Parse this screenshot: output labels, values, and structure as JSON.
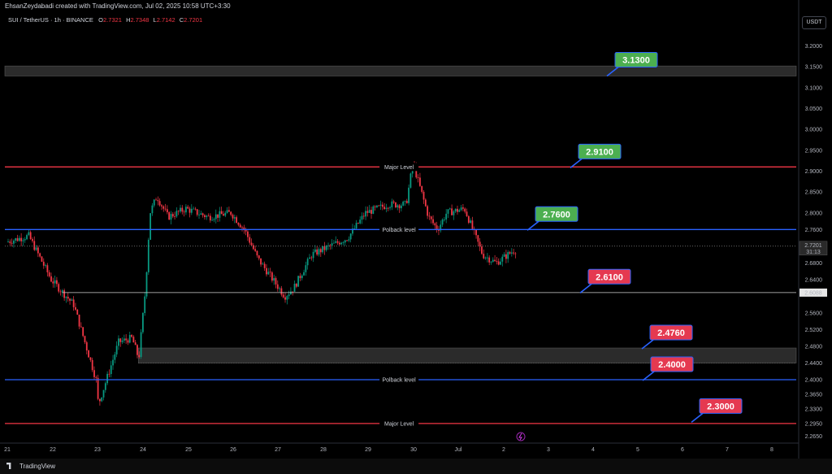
{
  "header": {
    "attribution": "EhsanZeydabadi created with TradingView.com, Jul 02, 2025 10:58 UTC+3:30",
    "symbol": "SUI / TetherUS · 1h · BINANCE",
    "ohlc": [
      {
        "key": "O",
        "value": "2.7321"
      },
      {
        "key": "H",
        "value": "2.7348"
      },
      {
        "key": "L",
        "value": "2.7142"
      },
      {
        "key": "C",
        "value": "2.7201"
      }
    ],
    "currency": "USDT"
  },
  "footer": {
    "brand": "TradingView"
  },
  "colors": {
    "background": "#000000",
    "bull": "#089981",
    "bear": "#f23645",
    "major_line": "#f23645",
    "pullback_line": "#2962ff",
    "tag_green": "#4caf50",
    "tag_red": "#e53950"
  },
  "chart_data": {
    "type": "candlestick",
    "ylim": [
      2.25,
      3.24
    ],
    "y_ticks": [
      "3.2000",
      "3.1500",
      "3.1000",
      "3.0500",
      "3.0000",
      "2.9500",
      "2.9000",
      "2.8500",
      "2.8000",
      "2.7600",
      "2.7201",
      "2.6800",
      "2.6400",
      "2.6088",
      "2.5600",
      "2.5200",
      "2.4800",
      "2.4400",
      "2.4000",
      "2.3650",
      "2.3300",
      "2.2950",
      "2.2650"
    ],
    "x_ticks": [
      "21",
      "22",
      "23",
      "24",
      "25",
      "26",
      "27",
      "28",
      "29",
      "30",
      "Jul",
      "2",
      "3",
      "4",
      "5",
      "6",
      "7",
      "8"
    ],
    "last_price": {
      "value": "2.7201",
      "countdown": "31:13"
    },
    "marked_price": "2.6088",
    "levels": [
      {
        "price": 2.91,
        "label": "Major Level",
        "kind": "major"
      },
      {
        "price": 2.76,
        "label": "Polback level",
        "kind": "pullback"
      },
      {
        "price": 2.4,
        "label": "Polback level",
        "kind": "pullback"
      },
      {
        "price": 2.295,
        "label": "Major Level",
        "kind": "major"
      }
    ],
    "zones": [
      {
        "from": 3.128,
        "to": 3.152
      },
      {
        "from": 2.44,
        "to": 2.476
      }
    ],
    "annotations": [
      {
        "text": "3.1300",
        "price": 3.13,
        "tone": "green"
      },
      {
        "text": "2.9100",
        "price": 2.91,
        "tone": "green"
      },
      {
        "text": "2.7600",
        "price": 2.76,
        "tone": "green"
      },
      {
        "text": "2.6100",
        "price": 2.61,
        "tone": "red"
      },
      {
        "text": "2.4760",
        "price": 2.476,
        "tone": "red"
      },
      {
        "text": "2.4000",
        "price": 2.4,
        "tone": "red"
      },
      {
        "text": "2.3000",
        "price": 2.3,
        "tone": "red"
      }
    ],
    "price_path": [
      [
        0.0,
        2.73
      ],
      [
        0.5,
        2.745
      ],
      [
        1.0,
        2.64
      ],
      [
        1.5,
        2.58
      ],
      [
        2.0,
        2.4
      ],
      [
        2.05,
        2.34
      ],
      [
        2.5,
        2.49
      ],
      [
        2.8,
        2.5
      ],
      [
        2.95,
        2.45
      ],
      [
        3.1,
        2.62
      ],
      [
        3.2,
        2.8
      ],
      [
        3.35,
        2.84
      ],
      [
        3.6,
        2.79
      ],
      [
        4.0,
        2.81
      ],
      [
        4.5,
        2.79
      ],
      [
        5.0,
        2.8
      ],
      [
        5.3,
        2.76
      ],
      [
        5.6,
        2.69
      ],
      [
        6.0,
        2.63
      ],
      [
        6.2,
        2.6
      ],
      [
        6.4,
        2.62
      ],
      [
        6.8,
        2.7
      ],
      [
        7.2,
        2.72
      ],
      [
        7.6,
        2.74
      ],
      [
        8.0,
        2.8
      ],
      [
        8.5,
        2.82
      ],
      [
        8.9,
        2.82
      ],
      [
        9.05,
        2.92
      ],
      [
        9.4,
        2.79
      ],
      [
        9.6,
        2.76
      ],
      [
        9.8,
        2.8
      ],
      [
        10.2,
        2.81
      ],
      [
        10.6,
        2.7
      ],
      [
        10.9,
        2.68
      ],
      [
        11.3,
        2.71
      ]
    ]
  }
}
